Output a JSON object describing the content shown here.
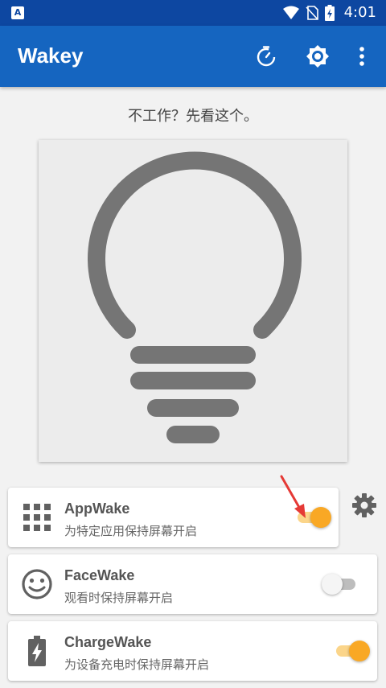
{
  "statusbar": {
    "time": "4:01",
    "badge": "A"
  },
  "appbar": {
    "title": "Wakey"
  },
  "hint": "不工作？先看这个。",
  "cards": [
    {
      "title": "AppWake",
      "subtitle": "为特定应用保持屏幕开启",
      "enabled": true
    },
    {
      "title": "FaceWake",
      "subtitle": "观看时保持屏幕开启",
      "enabled": false
    },
    {
      "title": "ChargeWake",
      "subtitle": "为设备充电时保持屏幕开启",
      "enabled": true
    }
  ],
  "colors": {
    "primary": "#1565c0",
    "statusbar": "#0d47a1",
    "accent": "#f9a825",
    "icon": "#757575"
  }
}
